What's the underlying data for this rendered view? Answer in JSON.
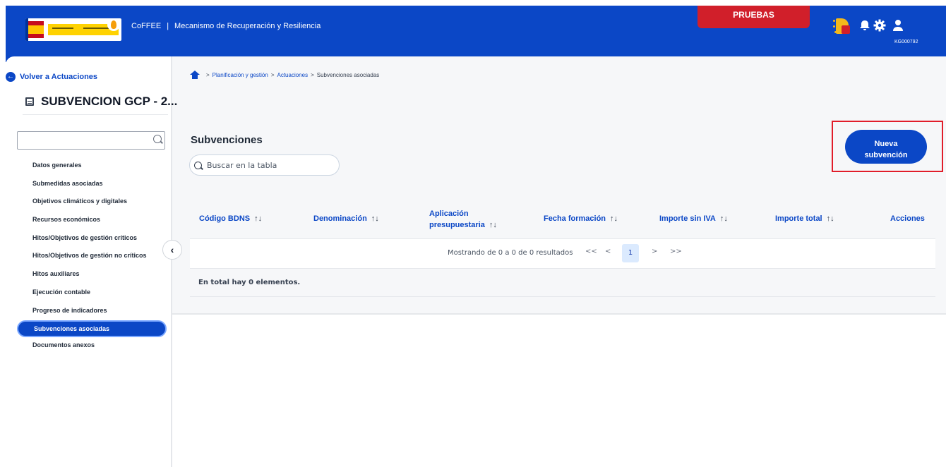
{
  "header": {
    "app_name": "CoFFEE",
    "separator": "|",
    "module_title": "Mecanismo de Recuperación y Resiliencia",
    "environment_badge": "PRUEBAS",
    "user_code": "KG000792",
    "icons": [
      "bell-icon",
      "gear-icon",
      "user-icon"
    ],
    "brand_color": "#0b47c6",
    "badge_color": "#d11f2a"
  },
  "sidebar": {
    "back_label": "Volver a Actuaciones",
    "entity_title": "SUBVENCION GCP - 2...",
    "search_value": "",
    "items": [
      {
        "label": "Datos generales",
        "active": false
      },
      {
        "label": "Submedidas asociadas",
        "active": false
      },
      {
        "label": "Objetivos climáticos y digitales",
        "active": false
      },
      {
        "label": "Recursos económicos",
        "active": false
      },
      {
        "label": "Hitos/Objetivos de gestión críticos",
        "active": false
      },
      {
        "label": "Hitos/Objetivos de gestión no críticos",
        "active": false
      },
      {
        "label": "Hitos auxiliares",
        "active": false
      },
      {
        "label": "Ejecución contable",
        "active": false
      },
      {
        "label": "Progreso de indicadores",
        "active": false
      },
      {
        "label": "Subvenciones asociadas",
        "active": true
      },
      {
        "label": "Documentos anexos",
        "active": false
      }
    ],
    "collapse_glyph": "‹"
  },
  "breadcrumb": {
    "items": [
      "Planificación y gestión",
      "Actuaciones"
    ],
    "current": "Subvenciones asociadas",
    "separator": ">"
  },
  "main": {
    "title": "Subvenciones",
    "search_placeholder": "Buscar en la tabla",
    "new_button_line1": "Nueva",
    "new_button_line2": "subvención"
  },
  "table": {
    "columns": [
      "Código BDNS",
      "Denominación",
      "Aplicación",
      "presupuestaria",
      "Fecha formación",
      "Importe sin IVA",
      "Importe total",
      "Acciones"
    ],
    "sort_glyph": "↑↓",
    "pagination_text": "Mostrando de 0 a 0 de 0 resultados",
    "first": "<<",
    "prev": "<",
    "page": "1",
    "next": ">",
    "last": ">>",
    "total_text": "En total hay 0 elementos."
  }
}
